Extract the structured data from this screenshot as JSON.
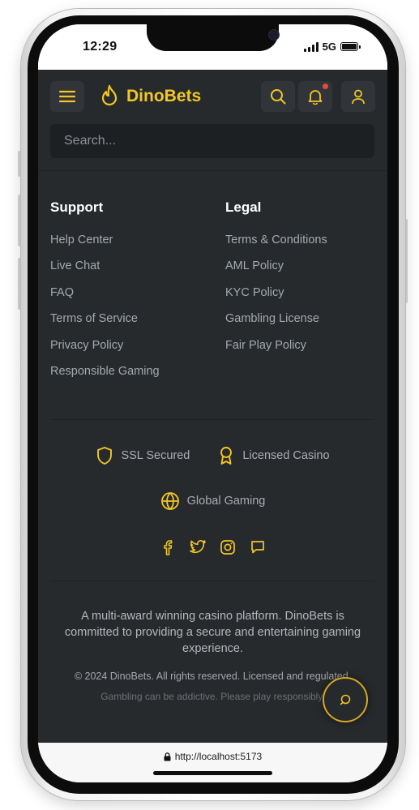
{
  "status_bar": {
    "time": "12:29",
    "network": "5G"
  },
  "header": {
    "brand": "DinoBets",
    "search_placeholder": "Search...",
    "has_notification": true,
    "accent_color": "#f3c623"
  },
  "footer": {
    "support": {
      "title": "Support",
      "links": [
        "Help Center",
        "Live Chat",
        "FAQ",
        "Terms of Service",
        "Privacy Policy",
        "Responsible Gaming"
      ]
    },
    "legal": {
      "title": "Legal",
      "links": [
        "Terms & Conditions",
        "AML Policy",
        "KYC Policy",
        "Gambling License",
        "Fair Play Policy"
      ]
    },
    "badges": {
      "ssl": "SSL Secured",
      "licensed": "Licensed Casino",
      "global": "Global Gaming"
    },
    "socials": [
      "facebook-icon",
      "twitter-icon",
      "instagram-icon",
      "chat-icon"
    ],
    "about": "A multi-award winning casino platform. DinoBets is committed to providing a secure and entertaining gaming experience.",
    "copyright": "© 2024 DinoBets. All rights reserved. Licensed and regulated.",
    "warning": "Gambling can be addictive. Please play responsibly."
  },
  "browser": {
    "url": "http://localhost:5173"
  }
}
